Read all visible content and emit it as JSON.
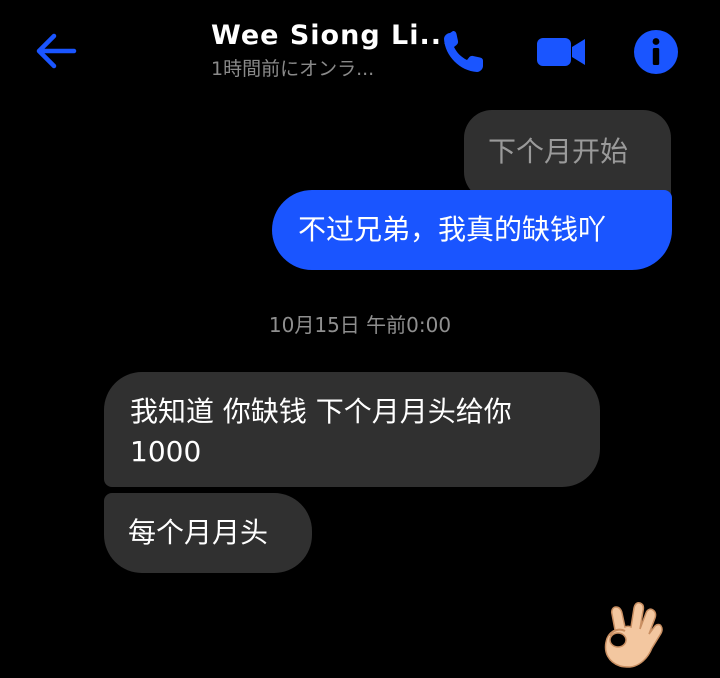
{
  "header": {
    "contact_name": "Wee Siong Li...",
    "status": "1時間前にオンラ...",
    "back_icon": "arrow-left-icon",
    "call_icon": "phone-icon",
    "video_icon": "video-camera-icon",
    "info_icon": "info-icon",
    "accent_color": "#1a55ff"
  },
  "messages": [
    {
      "side": "sent",
      "text": "下个月开始"
    },
    {
      "side": "sent",
      "text": "不过兄弟，我真的缺钱吖"
    },
    {
      "side": "received",
      "lines": [
        "我知道 你缺钱 下个月月头给你",
        "1000"
      ]
    },
    {
      "side": "received",
      "text": "每个月月头"
    }
  ],
  "timestamp": "10月15日 午前0:00",
  "reaction": {
    "icon": "ok-hand-emoji"
  }
}
